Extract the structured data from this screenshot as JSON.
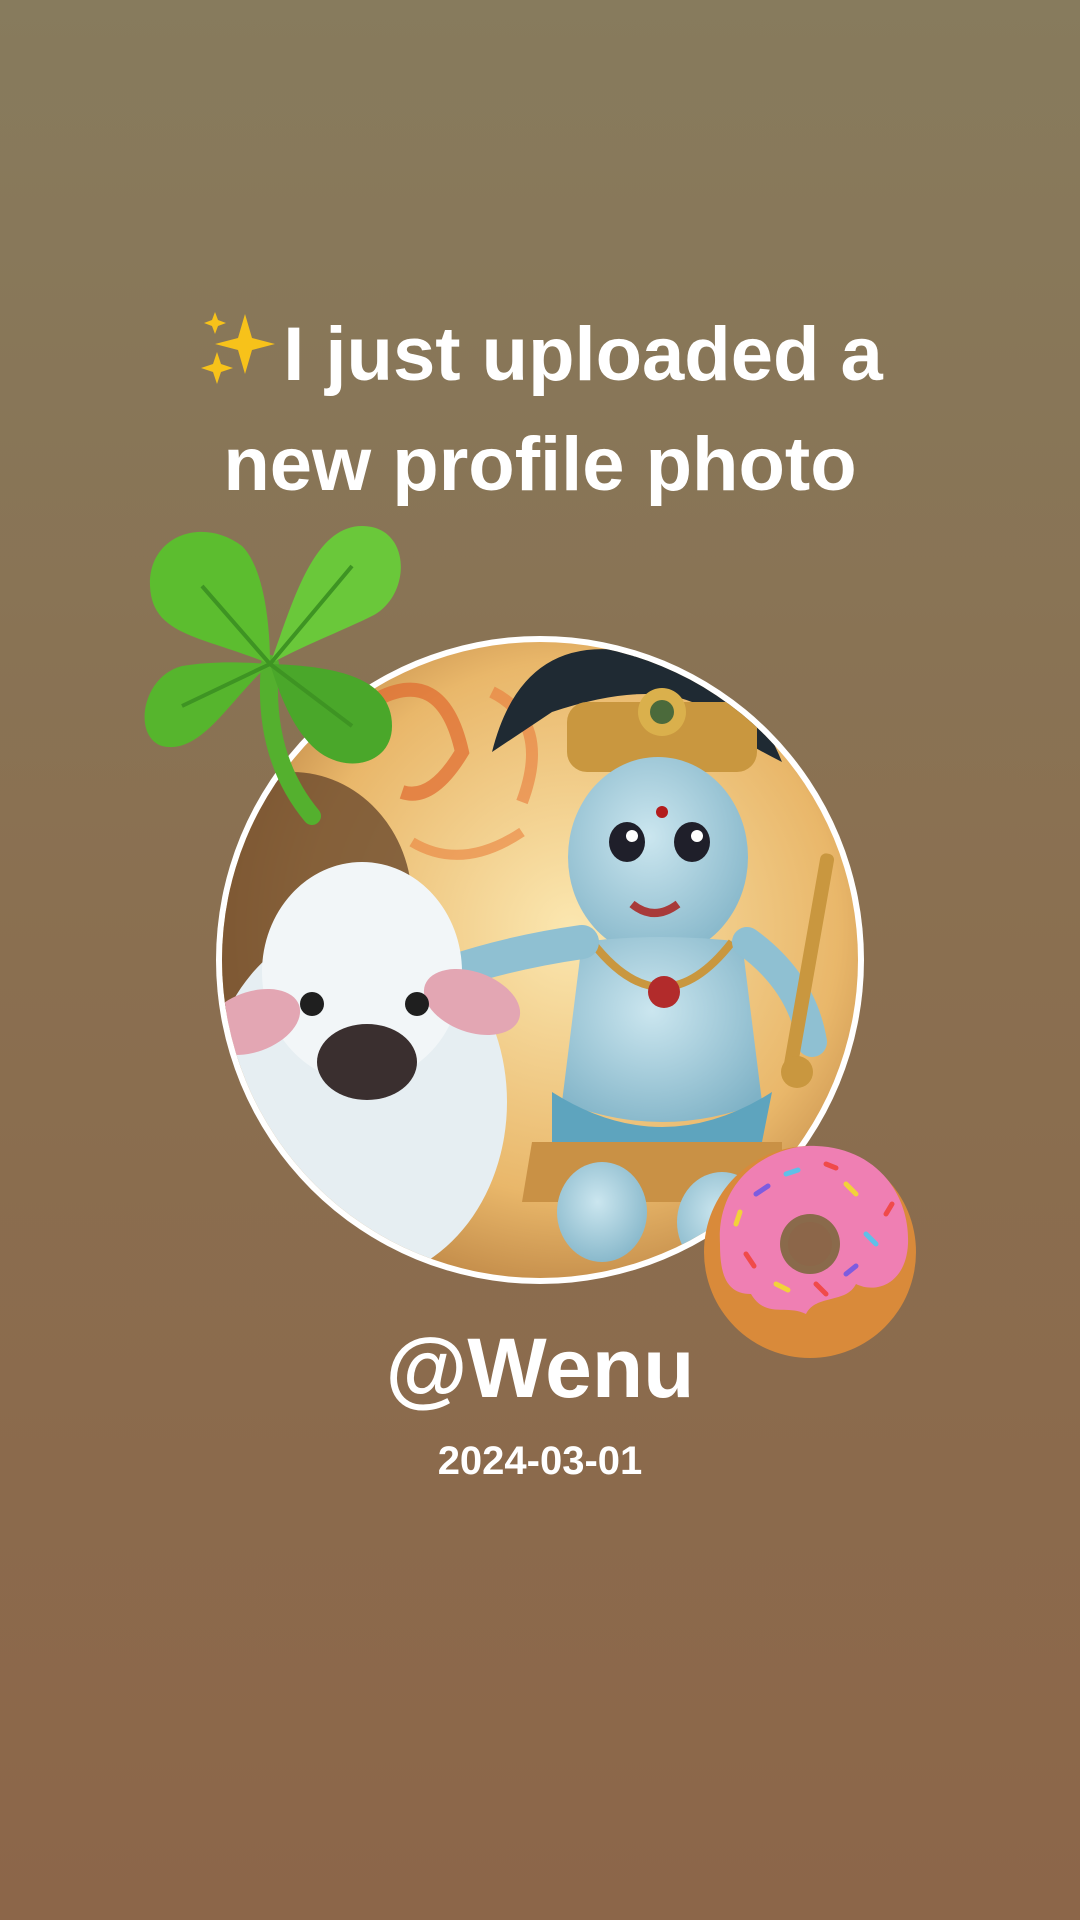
{
  "story": {
    "headline_emoji": "sparkles-icon",
    "headline_line1": "I just uploaded a",
    "headline_line2": "new profile photo",
    "username": "@Wenu",
    "date": "2024-03-01",
    "stickers": [
      "four-leaf-clover-icon",
      "donut-icon"
    ]
  },
  "colors": {
    "background_top": "#877b5d",
    "background_bottom": "#8c6649",
    "text": "#ffffff",
    "photo_border": "#ffffff"
  }
}
